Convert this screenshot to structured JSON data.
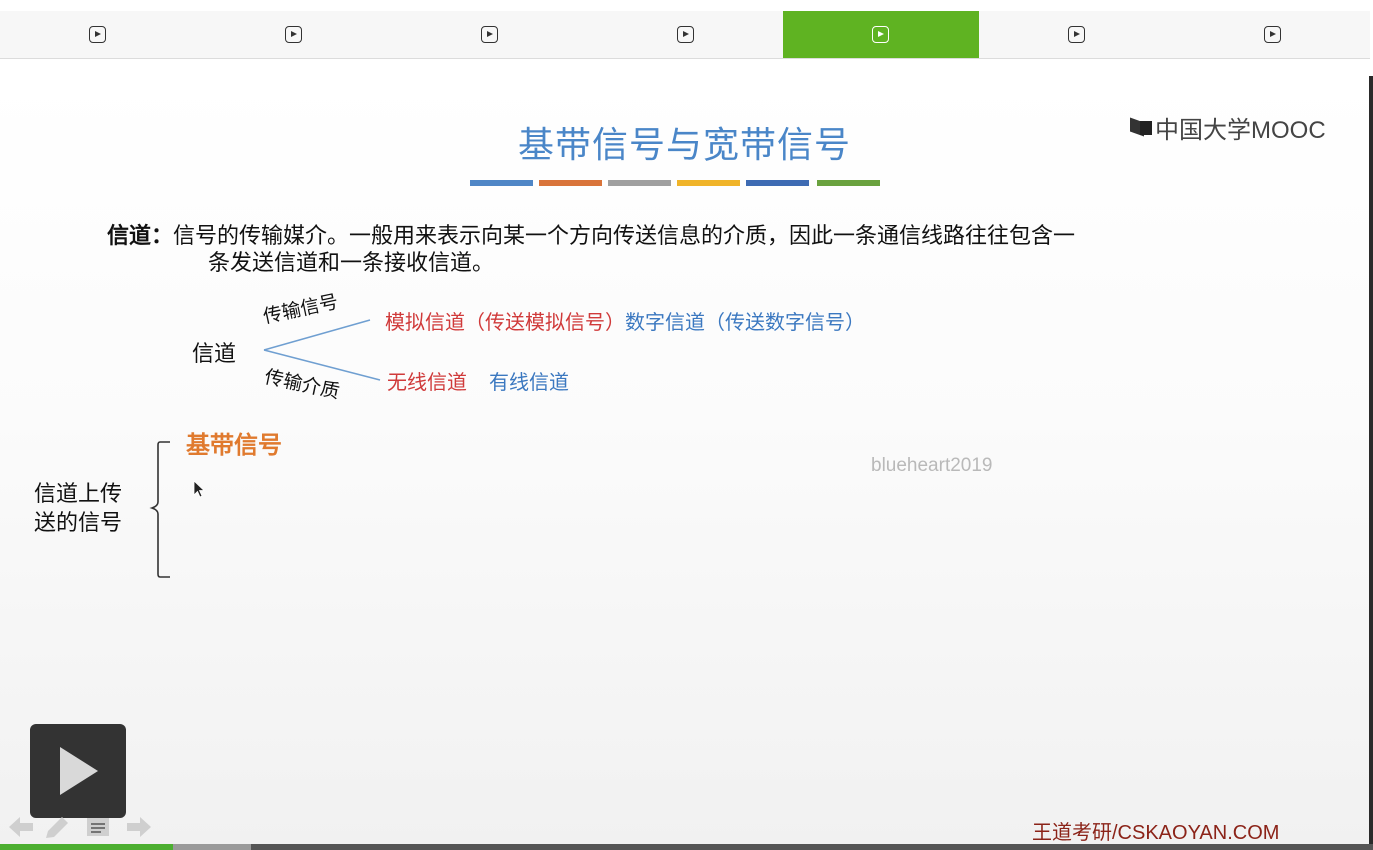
{
  "tabs": [
    {
      "icon": "play-icon",
      "active": false
    },
    {
      "icon": "play-icon",
      "active": false
    },
    {
      "icon": "play-icon",
      "active": false
    },
    {
      "icon": "play-icon",
      "active": false
    },
    {
      "icon": "play-icon",
      "active": true
    },
    {
      "icon": "play-icon",
      "active": false
    },
    {
      "icon": "play-icon",
      "active": false
    }
  ],
  "colors": {
    "active_tab": "#5fb322",
    "title": "#4a86c8",
    "accent_red": "#d03a3a",
    "accent_blue": "#3b78c0",
    "accent_orange": "#e07a2e",
    "brand": "#8b2318",
    "title_underline": [
      "#4f86c6",
      "#d9743a",
      "#a0a0a0",
      "#f0b429",
      "#3e6bb3",
      "#6aa23f"
    ]
  },
  "slide": {
    "title": "基带信号与宽带信号",
    "logo_text": "中国大学MOOC",
    "definition": {
      "term": "信道",
      "colon": "：",
      "line1": "信号的传输媒介。一般用来表示向某一个方向传送信息的介质，因此一条通信线路往往包含一",
      "line2": "条发送信道和一条接收信道。"
    },
    "tree": {
      "root": "信道",
      "branch_up": "传输信号",
      "branch_down": "传输介质",
      "row1_red": "模拟信道（传送模拟信号）",
      "row1_blue": "数字信道（传送数字信号）",
      "row2_red": "无线信道",
      "row2_blue": "有线信道"
    },
    "signals": {
      "left_label_line1": "信道上传",
      "left_label_line2": "送的信号",
      "baseband": "基带信号"
    },
    "watermark": "blueheart2019",
    "footer_brand": "王道考研/CSKAOYAN.COM"
  },
  "player": {
    "progress": 0.126,
    "buffered": 0.183,
    "controls": [
      "arrow-left-icon",
      "pen-icon",
      "notes-icon",
      "arrow-right-icon"
    ]
  }
}
